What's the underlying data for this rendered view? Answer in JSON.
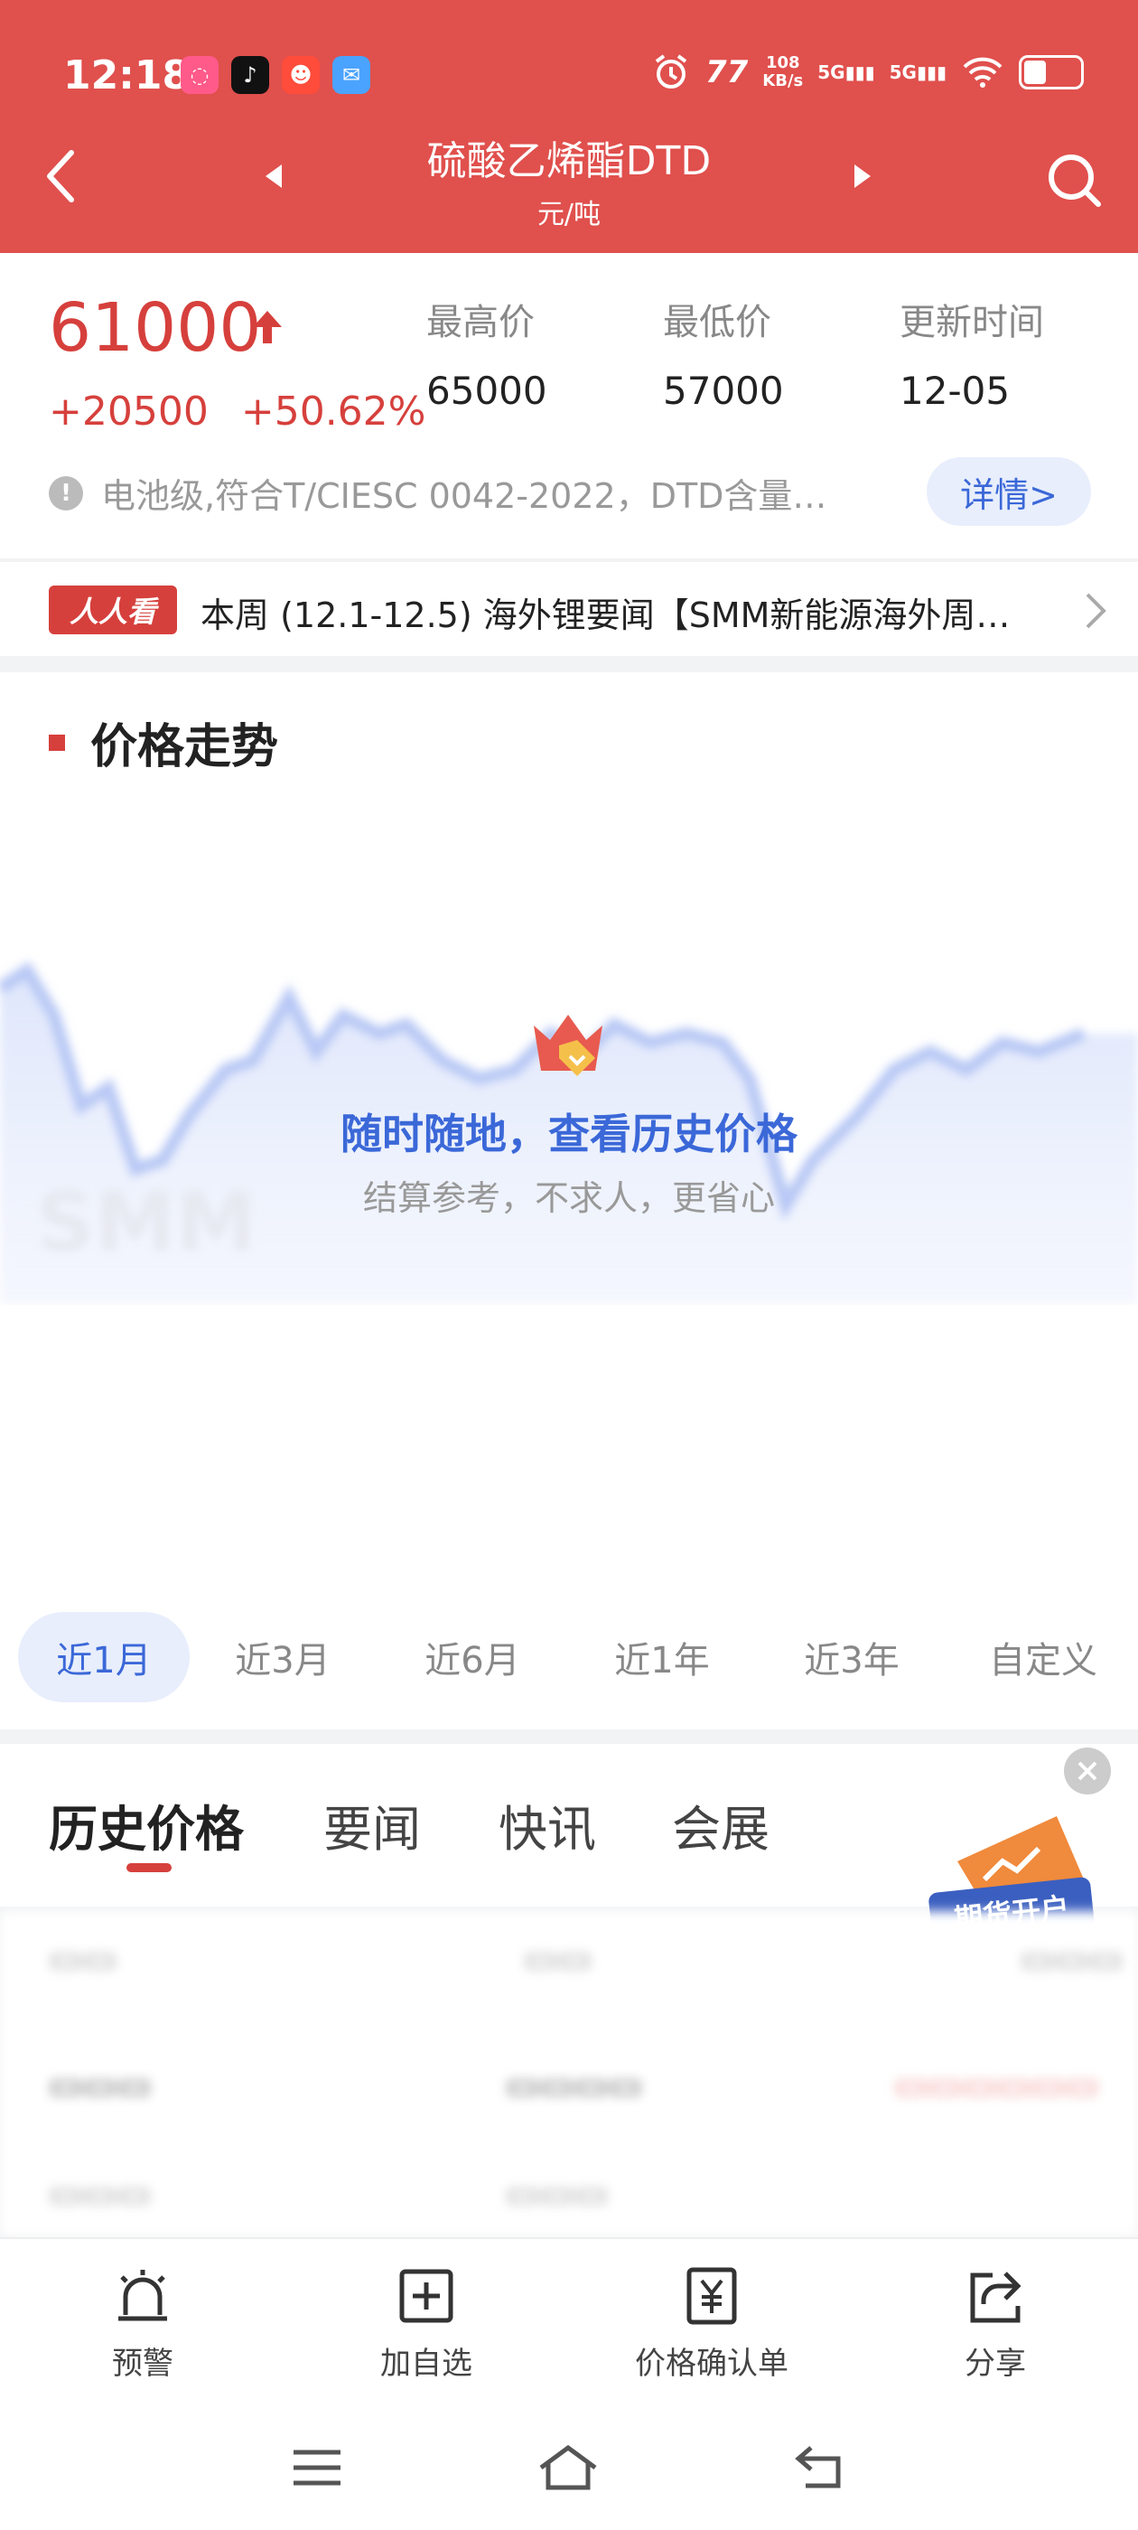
{
  "status_bar": {
    "time": "12:18",
    "net_speed": "108\nKB/s",
    "net1": "5G",
    "net2": "5G"
  },
  "header": {
    "title": "硫酸乙烯酯DTD",
    "unit": "元/吨"
  },
  "price": {
    "current": "61000",
    "change_abs": "+20500",
    "change_pct": "+50.62%",
    "stats": [
      {
        "label": "最高价",
        "value": "65000"
      },
      {
        "label": "最低价",
        "value": "57000"
      },
      {
        "label": "更新时间",
        "value": "12-05"
      }
    ],
    "note": "电池级,符合T/CIESC 0042-2022，DTD含量…",
    "details_label": "详情>"
  },
  "ticker": {
    "badge": "人人看",
    "text": "本周 (12.1-12.5) 海外锂要闻【SMM新能源海外周…"
  },
  "chart": {
    "section_title": "价格走势",
    "overlay_title": "随时随地，查看历史价格",
    "overlay_sub": "结算参考，不求人，更省心",
    "watermark": "SMM",
    "ranges": [
      "近1月",
      "近3月",
      "近6月",
      "近1年",
      "近3年",
      "自定义"
    ],
    "active_range": 0
  },
  "tabs": {
    "items": [
      "历史价格",
      "要闻",
      "快讯",
      "会展"
    ],
    "active": 0
  },
  "promo": {
    "label": "期货开户"
  },
  "toolbar": {
    "items": [
      {
        "label": "预警",
        "icon": "alarm-icon"
      },
      {
        "label": "加自选",
        "icon": "add-box-icon"
      },
      {
        "label": "价格确认单",
        "icon": "yuan-doc-icon"
      },
      {
        "label": "分享",
        "icon": "share-icon"
      }
    ]
  },
  "colors": {
    "header_bg": "#e0504d",
    "price_red": "#d6403c",
    "accent_blue": "#3b68d8"
  }
}
